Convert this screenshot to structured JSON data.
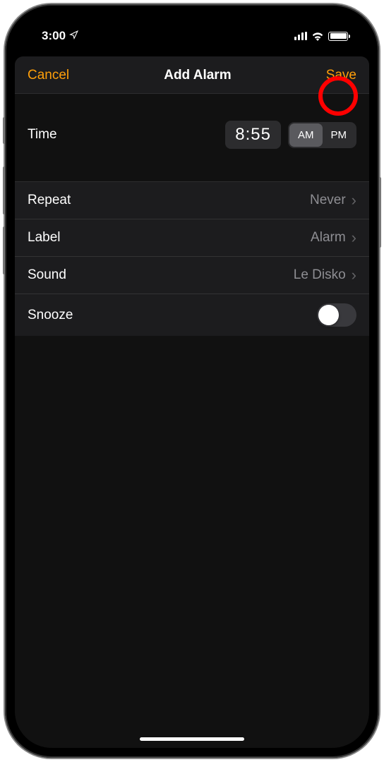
{
  "status": {
    "time": "3:00"
  },
  "nav": {
    "cancel": "Cancel",
    "title": "Add Alarm",
    "save": "Save"
  },
  "time": {
    "label": "Time",
    "value": "8:55",
    "am": "AM",
    "pm": "PM",
    "selected": "AM"
  },
  "settings": {
    "repeat": {
      "label": "Repeat",
      "value": "Never"
    },
    "label": {
      "label": "Label",
      "value": "Alarm"
    },
    "sound": {
      "label": "Sound",
      "value": "Le Disko"
    },
    "snooze": {
      "label": "Snooze",
      "on": false
    }
  }
}
